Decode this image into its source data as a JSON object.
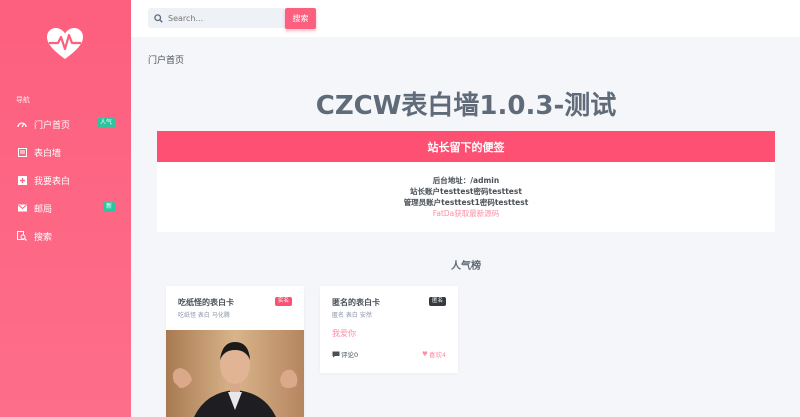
{
  "sidebar": {
    "nav_title": "导航",
    "items": [
      {
        "label": "门户首页",
        "icon": "gauge-icon",
        "badge": "人气",
        "badge_color": "#2ec4a0"
      },
      {
        "label": "表白墙",
        "icon": "list-icon",
        "badge": "",
        "badge_color": ""
      },
      {
        "label": "我要表白",
        "icon": "plus-square-icon",
        "badge": "",
        "badge_color": ""
      },
      {
        "label": "邮局",
        "icon": "mail-icon",
        "badge": "新",
        "badge_color": "#2ec4a0"
      },
      {
        "label": "搜索",
        "icon": "search-doc-icon",
        "badge": "",
        "badge_color": ""
      }
    ]
  },
  "topbar": {
    "search_placeholder": "Search...",
    "search_button": "搜索"
  },
  "breadcrumb": "门户首页",
  "page_title": "CZCW表白墙1.0.3-测试",
  "note": {
    "title": "站长留下的便签",
    "lines": [
      "后台地址：/admin",
      "站长账户testtest密码testtest",
      "管理员账户testtest1密码testtest"
    ],
    "link": "FatDa获取最新源码"
  },
  "ranking_title": "人气榜",
  "cards": [
    {
      "title": "吃纸怪的表白卡",
      "sub": "吃纸怪 表白 马化腾",
      "badge": "实名",
      "badge_color": "#fd5072"
    },
    {
      "title": "匿名的表白卡",
      "sub": "匿名 表白 安然",
      "badge": "匿名",
      "badge_color": "#343a40",
      "message": "我爱你",
      "comments": "评论0",
      "likes": "喜欢4"
    }
  ],
  "colors": {
    "accent": "#fd5f7e",
    "note_header": "#fd5072",
    "link": "#fd8ea5"
  }
}
